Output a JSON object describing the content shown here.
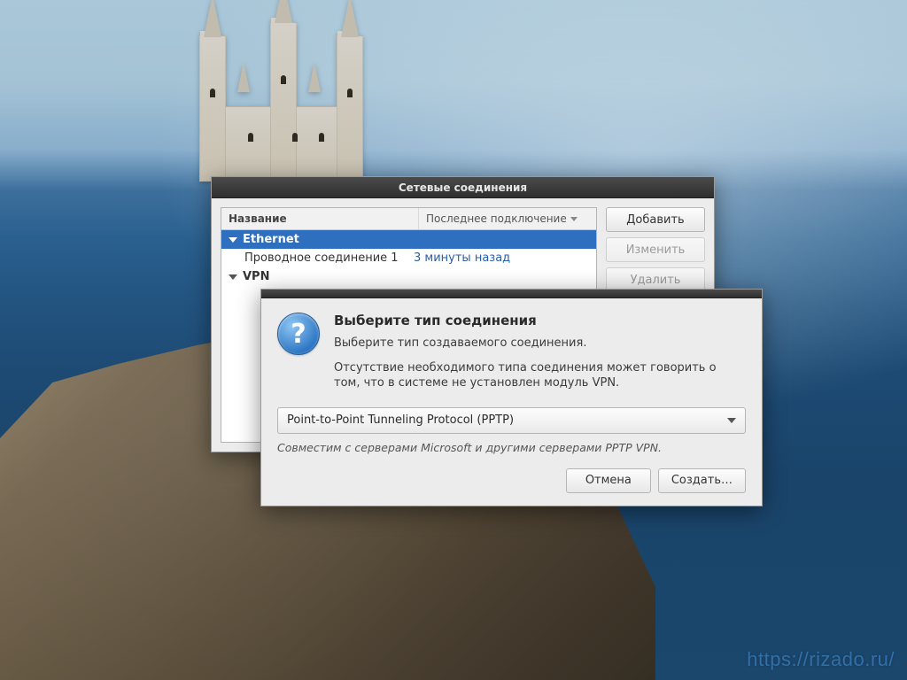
{
  "watermark": "https://rizado.ru/",
  "window_connections": {
    "title": "Сетевые соединения",
    "columns": {
      "name": "Название",
      "last": "Последнее подключение"
    },
    "groups": [
      {
        "label": "Ethernet",
        "selected": true,
        "items": [
          {
            "name": "Проводное соединение 1",
            "last": "3 минуты назад"
          }
        ]
      },
      {
        "label": "VPN",
        "selected": false,
        "items": []
      }
    ],
    "buttons": {
      "add": {
        "label": "Добавить",
        "enabled": true
      },
      "edit": {
        "label": "Изменить",
        "enabled": false
      },
      "delete": {
        "label": "Удалить",
        "enabled": false
      }
    }
  },
  "dialog": {
    "heading": "Выберите тип соединения",
    "subheading": "Выберите тип создаваемого соединения.",
    "note": "Отсутствие необходимого типа соединения может говорить о том, что в системе не установлен модуль VPN.",
    "combo_value": "Point-to-Point Tunneling Protocol (PPTP)",
    "hint": "Совместим с серверами Microsoft и другими серверами PPTP VPN.",
    "cancel": "Отмена",
    "create": "Создать…"
  }
}
